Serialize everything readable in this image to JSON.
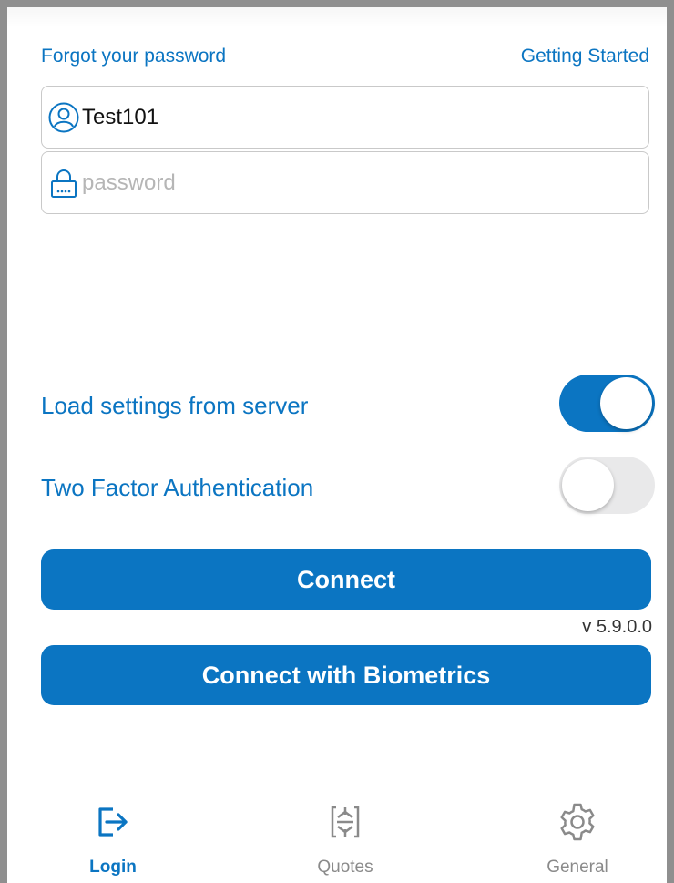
{
  "header": {
    "forgot_password": "Forgot your password",
    "getting_started": "Getting Started"
  },
  "login": {
    "username_value": "Test101",
    "username_icon": "user-icon",
    "password_value": "",
    "password_placeholder": "password",
    "password_icon": "lock-icon"
  },
  "settings": {
    "load_settings_label": "Load settings from server",
    "load_settings_on": true,
    "two_factor_label": "Two Factor Authentication",
    "two_factor_on": false
  },
  "actions": {
    "connect_label": "Connect",
    "version": "v 5.9.0.0",
    "connect_biometrics_label": "Connect with Biometrics"
  },
  "tabbar": {
    "items": [
      {
        "label": "Login",
        "icon": "login-arrow-icon",
        "active": true
      },
      {
        "label": "Quotes",
        "icon": "quotes-icon",
        "active": false
      },
      {
        "label": "General",
        "icon": "gear-icon",
        "active": false
      }
    ]
  },
  "colors": {
    "accent": "#0b75c2",
    "toggle_off": "#e9e9ea",
    "inactive_tab": "#8a8a8a"
  }
}
